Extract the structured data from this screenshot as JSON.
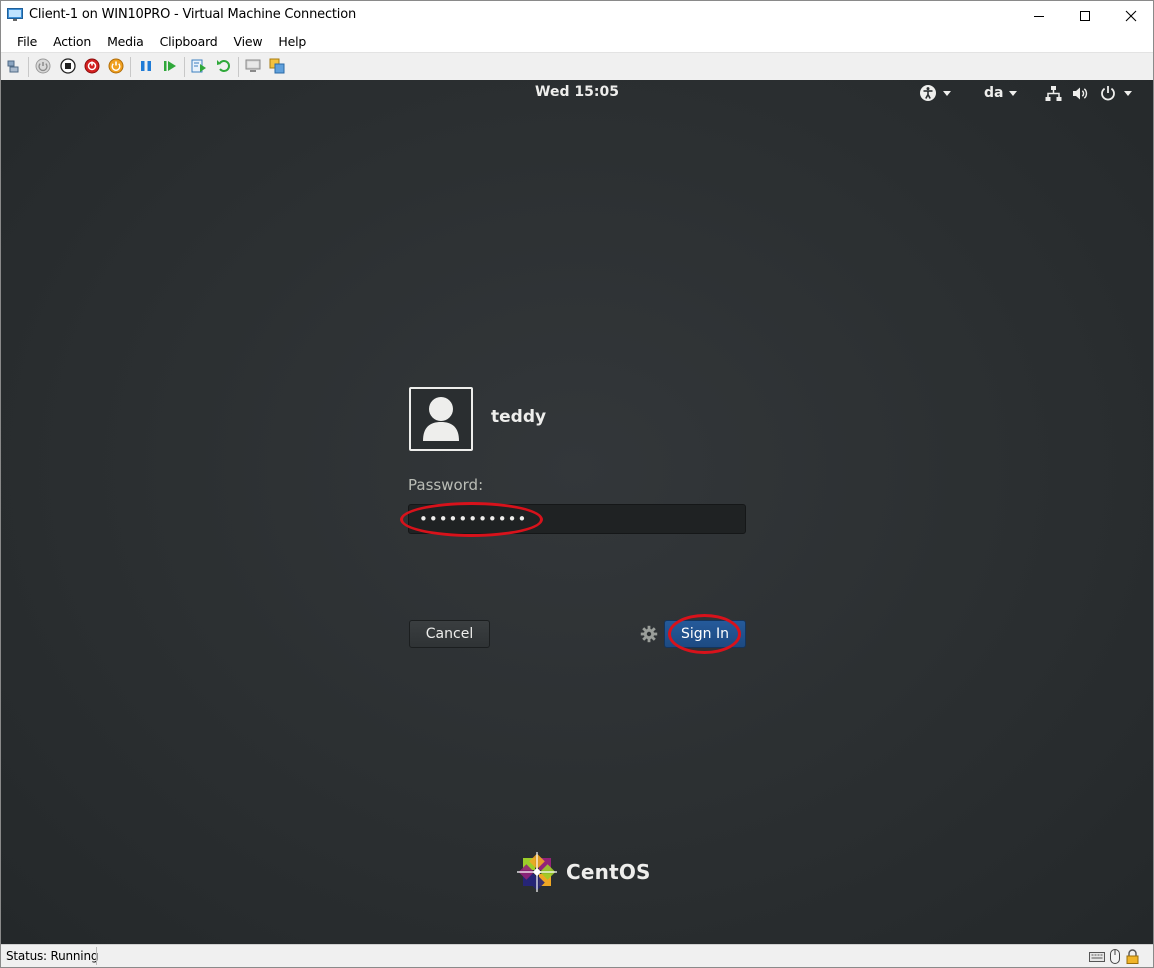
{
  "window": {
    "title": "Client-1 on WIN10PRO - Virtual Machine Connection",
    "controls": [
      "minimize-icon",
      "maximize-icon",
      "close-icon"
    ]
  },
  "menu": {
    "items": [
      "File",
      "Action",
      "Media",
      "Clipboard",
      "View",
      "Help"
    ]
  },
  "toolbar": {
    "icons": [
      "ctrl-alt-del-icon",
      "start-icon",
      "turn-off-icon",
      "shut-down-icon",
      "save-icon",
      "pause-icon",
      "resume-icon",
      "checkpoint-icon",
      "revert-icon",
      "enhanced-session-icon",
      "share-icon"
    ]
  },
  "gnome_topbar": {
    "clock": "Wed 15:05",
    "language": "da"
  },
  "login": {
    "username": "teddy",
    "password_label": "Password:",
    "password_mask": "•••••••••••",
    "cancel_label": "Cancel",
    "signin_label": "Sign In"
  },
  "branding": {
    "logo_text": "CentOS"
  },
  "status": {
    "text": "Status: Running"
  },
  "colors": {
    "accent": "#1d4a82",
    "highlight": "#d8121b",
    "screen_bg": "#2b2f31"
  }
}
